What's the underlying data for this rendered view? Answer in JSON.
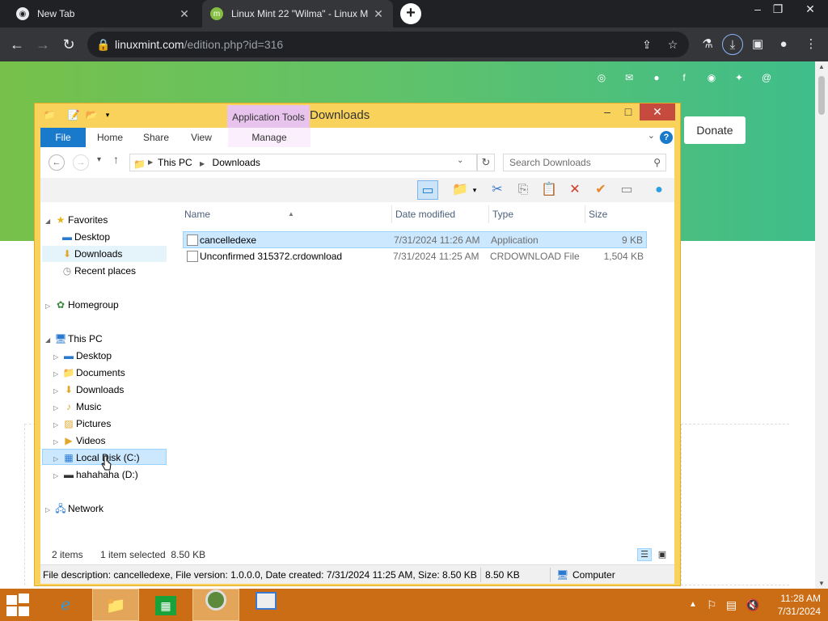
{
  "browser": {
    "tabs": [
      {
        "title": "New Tab",
        "close": "✕"
      },
      {
        "title": "Linux Mint 22 \"Wilma\" - Linux M",
        "close": "✕"
      }
    ],
    "new_tab": "+",
    "url_host": "linuxmint.com",
    "url_path": "/edition.php?id=316",
    "window_controls": {
      "minimize": "–",
      "restore": "❐",
      "close": "✕"
    }
  },
  "page": {
    "donate_label": "Donate"
  },
  "explorer": {
    "title": "Downloads",
    "context_tab": "Application Tools",
    "ribbon_tabs": [
      "File",
      "Home",
      "Share",
      "View",
      "Manage"
    ],
    "breadcrumb": [
      "This PC",
      "Downloads"
    ],
    "search_placeholder": "Search Downloads",
    "nav": {
      "favorites": "Favorites",
      "favorites_items": [
        "Desktop",
        "Downloads",
        "Recent places"
      ],
      "homegroup": "Homegroup",
      "this_pc": "This PC",
      "this_pc_items": [
        "Desktop",
        "Documents",
        "Downloads",
        "Music",
        "Pictures",
        "Videos",
        "Local Disk (C:)",
        "hahahaha (D:)"
      ],
      "network": "Network"
    },
    "columns": [
      "Name",
      "Date modified",
      "Type",
      "Size"
    ],
    "files": [
      {
        "name": "cancelledexe",
        "date": "7/31/2024 11:26 AM",
        "type": "Application",
        "size": "9 KB"
      },
      {
        "name": "Unconfirmed 315372.crdownload",
        "date": "7/31/2024 11:25 AM",
        "type": "CRDOWNLOAD File",
        "size": "1,504 KB"
      }
    ],
    "status": {
      "items": "2 items",
      "selected": "1 item selected  8.50 KB"
    },
    "info": {
      "description": "File description: cancelledexe, File version: 1.0.0.0, Date created: 7/31/2024 11:25 AM, Size: 8.50 KB",
      "size": "8.50 KB",
      "location": "Computer"
    }
  },
  "taskbar": {
    "time": "11:28 AM",
    "date": "7/31/2024"
  }
}
